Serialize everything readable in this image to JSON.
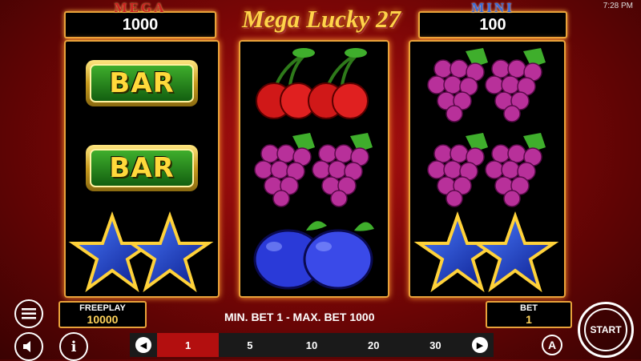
{
  "status_bar": {
    "time": "7:28 PM"
  },
  "jackpots": {
    "mega": {
      "title": "MEGA",
      "value": "1000"
    },
    "mini": {
      "title": "MINI",
      "value": "100"
    }
  },
  "game": {
    "logo": "Mega Lucky 27"
  },
  "reels": [
    [
      "bar",
      "bar",
      "star"
    ],
    [
      "cherry",
      "grape",
      "plum"
    ],
    [
      "grape",
      "grape",
      "star"
    ]
  ],
  "symbols": {
    "bar_text": "BAR"
  },
  "bottom": {
    "freeplay_label": "FREEPLAY",
    "freeplay_value": "10000",
    "bet_info": "MIN. BET 1 - MAX. BET 1000",
    "bet_label": "BET",
    "bet_value": "1",
    "start_label": "START",
    "auto_label": "A",
    "bet_options": [
      "1",
      "5",
      "10",
      "20",
      "30"
    ],
    "selected_bet": "1"
  },
  "colors": {
    "frame": "#e8a23a",
    "background": "#7a0606",
    "selected_bet": "#b30f0f",
    "value_text": "#ffd35a"
  },
  "icons": [
    "menu-icon",
    "sound-icon",
    "info-icon",
    "prev-arrow-icon",
    "next-arrow-icon",
    "start-icon",
    "autoplay-icon"
  ]
}
